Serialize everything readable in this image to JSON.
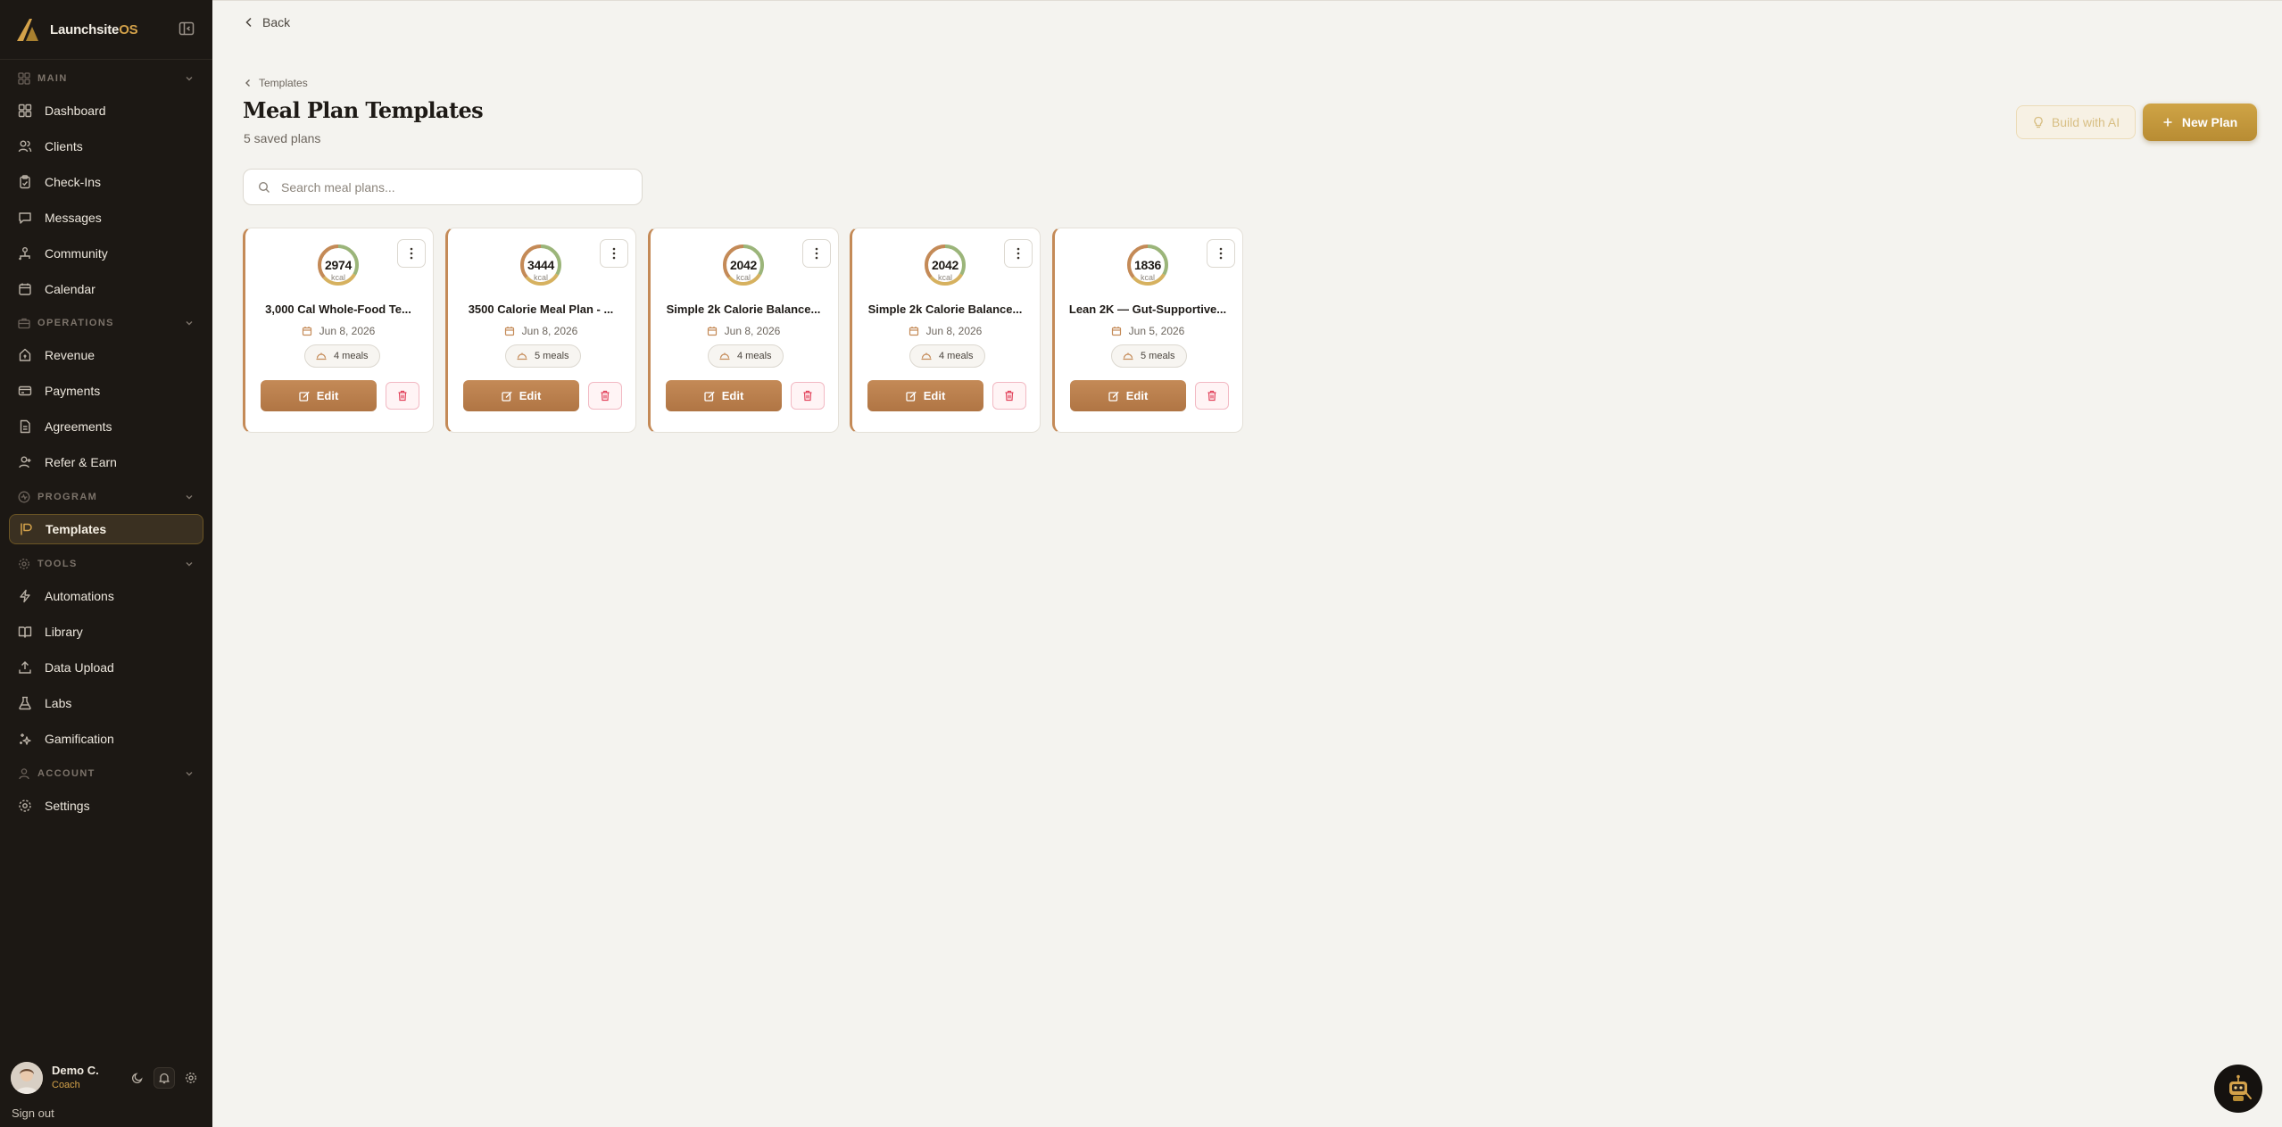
{
  "brand": {
    "name": "Launchsite",
    "name_accent": "OS"
  },
  "sidebar": {
    "sections": [
      {
        "label": "MAIN",
        "icon": "grid-icon"
      },
      {
        "label": "OPERATIONS",
        "icon": "briefcase-icon"
      },
      {
        "label": "PROGRAM",
        "icon": "pulse-icon"
      },
      {
        "label": "TOOLS",
        "icon": "settings-icon"
      },
      {
        "label": "ACCOUNT",
        "icon": "user-icon"
      }
    ],
    "items": [
      {
        "label": "Dashboard",
        "icon": "grid-icon"
      },
      {
        "label": "Clients",
        "icon": "users-icon"
      },
      {
        "label": "Check-Ins",
        "icon": "clipboard-check-icon"
      },
      {
        "label": "Messages",
        "icon": "message-icon"
      },
      {
        "label": "Community",
        "icon": "community-icon"
      },
      {
        "label": "Calendar",
        "icon": "calendar-icon"
      },
      {
        "label": "Revenue",
        "icon": "revenue-icon"
      },
      {
        "label": "Payments",
        "icon": "credit-card-icon"
      },
      {
        "label": "Agreements",
        "icon": "document-icon"
      },
      {
        "label": "Refer & Earn",
        "icon": "refer-icon"
      },
      {
        "label": "Templates",
        "icon": "templates-icon",
        "active": true
      },
      {
        "label": "Automations",
        "icon": "lightning-icon"
      },
      {
        "label": "Library",
        "icon": "book-icon"
      },
      {
        "label": "Data Upload",
        "icon": "upload-icon"
      },
      {
        "label": "Labs",
        "icon": "flask-icon"
      },
      {
        "label": "Gamification",
        "icon": "sparkle-icon"
      },
      {
        "label": "Settings",
        "icon": "gear-icon"
      }
    ]
  },
  "user": {
    "name": "Demo C.",
    "role": "Coach",
    "sign_out": "Sign out"
  },
  "header": {
    "back": "Back",
    "breadcrumb": "Templates",
    "title": "Meal Plan Templates",
    "subtitle": "5 saved plans"
  },
  "actions": {
    "build_ai": "Build with AI",
    "new_plan": "New Plan"
  },
  "search": {
    "placeholder": "Search meal plans..."
  },
  "colors": {
    "accent": "#c48a57",
    "gold": "#c99b3f",
    "sidebar_bg": "#1c1814",
    "danger": "#e2445c"
  },
  "plans": [
    {
      "kcal": "2974",
      "unit": "kcal",
      "title": "3,000 Cal Whole-Food Te...",
      "date": "Jun 8, 2026",
      "meals": "4 meals",
      "edit": "Edit"
    },
    {
      "kcal": "3444",
      "unit": "kcal",
      "title": "3500 Calorie Meal Plan - ...",
      "date": "Jun 8, 2026",
      "meals": "5 meals",
      "edit": "Edit"
    },
    {
      "kcal": "2042",
      "unit": "kcal",
      "title": "Simple 2k Calorie Balance...",
      "date": "Jun 8, 2026",
      "meals": "4 meals",
      "edit": "Edit"
    },
    {
      "kcal": "2042",
      "unit": "kcal",
      "title": "Simple 2k Calorie Balance...",
      "date": "Jun 8, 2026",
      "meals": "4 meals",
      "edit": "Edit"
    },
    {
      "kcal": "1836",
      "unit": "kcal",
      "title": "Lean 2K — Gut-Supportive...",
      "date": "Jun 5, 2026",
      "meals": "5 meals",
      "edit": "Edit"
    }
  ]
}
